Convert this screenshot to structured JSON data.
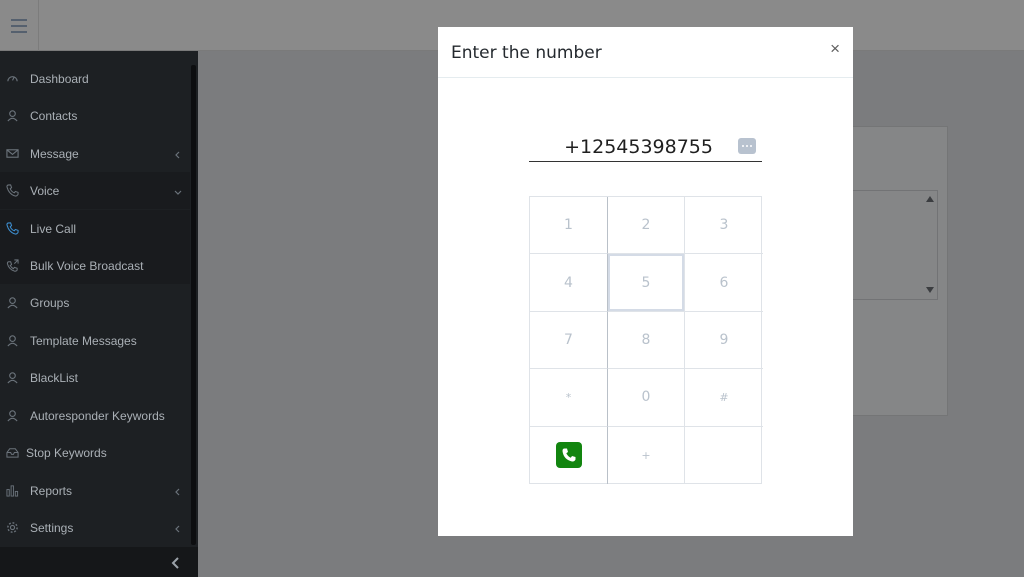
{
  "sidebar": {
    "items": [
      {
        "label": "Dashboard",
        "icon": "dashboard-icon"
      },
      {
        "label": "Contacts",
        "icon": "contacts-icon"
      },
      {
        "label": "Message",
        "icon": "envelope-icon"
      },
      {
        "label": "Voice",
        "icon": "phone-icon"
      },
      {
        "label": "Live Call",
        "icon": "phone-icon"
      },
      {
        "label": "Bulk Voice Broadcast",
        "icon": "phone-forward-icon"
      },
      {
        "label": "Groups",
        "icon": "groups-icon"
      },
      {
        "label": "Template Messages",
        "icon": "template-icon"
      },
      {
        "label": "BlackList",
        "icon": "blacklist-icon"
      },
      {
        "label": "Autoresponder Keywords",
        "icon": "autoresponder-icon"
      },
      {
        "label": "Stop Keywords",
        "icon": "stop-icon"
      },
      {
        "label": "Reports",
        "icon": "bar-chart-icon"
      },
      {
        "label": "Settings",
        "icon": "gear-icon"
      }
    ]
  },
  "modal": {
    "title": "Enter the number",
    "close": "×",
    "number": "+12545398755",
    "keys": [
      "1",
      "2",
      "3",
      "4",
      "5",
      "6",
      "7",
      "8",
      "9",
      "*",
      "0",
      "#",
      "",
      "+",
      ""
    ]
  },
  "colors": {
    "sidebar_bg": "#1d2023",
    "call_button": "#12850f",
    "overlay": "#7b7c7e"
  }
}
